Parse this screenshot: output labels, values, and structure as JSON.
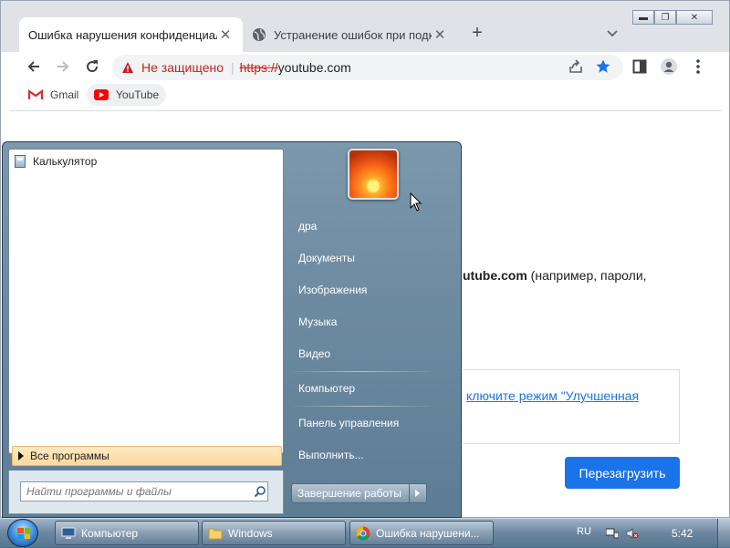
{
  "browser": {
    "tabs": [
      {
        "title": "Ошибка нарушения конфиденциальности",
        "active": true
      },
      {
        "title": "Устранение ошибок при подключении",
        "active": false
      }
    ],
    "new_tab": "+",
    "tab_close": "✕",
    "window_controls": {
      "minimize": "▬",
      "restore": "❐",
      "close": "✕"
    },
    "address": {
      "security_label": "Не защищено",
      "separator": "|",
      "scheme": "https://",
      "host": "youtube.com"
    },
    "bookmarks": [
      {
        "label": "Gmail",
        "icon": "gmail-icon"
      },
      {
        "label": "YouTube",
        "icon": "youtube-icon"
      }
    ],
    "page": {
      "text_bold": "utube.com",
      "text_rest": " (например, пароли,",
      "link_text": "ключите режим \"Улучшенная",
      "reload_button": "Перезагрузить"
    }
  },
  "start_menu": {
    "recent_programs": [
      {
        "label": "Калькулятор",
        "icon": "calculator-icon"
      }
    ],
    "all_programs": "Все программы",
    "search_placeholder": "Найти программы и файлы",
    "right_links": {
      "user": "дра",
      "documents": "Документы",
      "pictures": "Изображения",
      "music": "Музыка",
      "videos": "Видео",
      "computer": "Компьютер",
      "control_panel": "Панель управления",
      "run": "Выполнить..."
    },
    "shutdown": "Завершение работы"
  },
  "taskbar": {
    "buttons": [
      {
        "label": "Компьютер",
        "icon": "computer-icon"
      },
      {
        "label": "Windows",
        "icon": "folder-icon"
      },
      {
        "label": "Ошибка нарушени...",
        "icon": "chrome-icon"
      }
    ],
    "language": "RU",
    "clock": "5:42"
  },
  "colors": {
    "accent": "#1a73e8",
    "danger": "#c5221f",
    "allprograms_highlight": "#fbd89d"
  }
}
